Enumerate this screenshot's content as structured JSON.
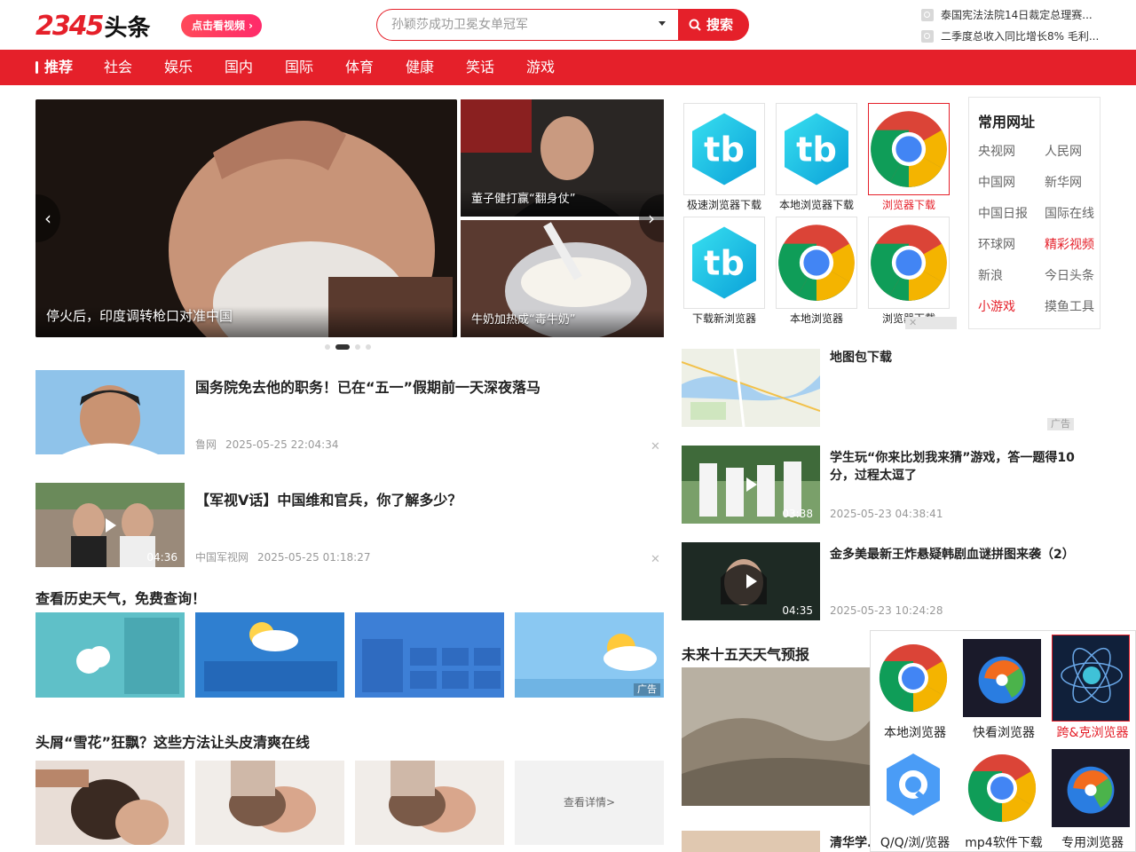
{
  "header": {
    "logo_num": "2345",
    "logo_cn": "头条",
    "video_btn": "点击看视频",
    "search_placeholder": "孙颖莎成功卫冕女单冠军",
    "search_btn": "搜索",
    "hot": [
      "泰国宪法法院14日裁定总理赛...",
      "二季度总收入同比增长8% 毛利..."
    ]
  },
  "nav": [
    "推荐",
    "社会",
    "娱乐",
    "国内",
    "国际",
    "体育",
    "健康",
    "笑话",
    "游戏"
  ],
  "carousel": {
    "main_caption": "停火后，印度调转枪口对准中国",
    "side_top_caption": "董子健打赢“翻身仗”",
    "side_bottom_caption": "牛奶加热成“毒牛奶”"
  },
  "news": [
    {
      "title": "国务院免去他的职务！已在“五一”假期前一天深夜落马",
      "source": "鲁网",
      "time": "2025-05-25 22:04:34"
    },
    {
      "title": "【军视V话】中国维和官兵，你了解多少？",
      "source": "中国军视网",
      "time": "2025-05-25 01:18:27",
      "duration": "04:36"
    }
  ],
  "weather_section": {
    "title": "查看历史天气，免费查询！",
    "ad": "广告"
  },
  "scalp_section": {
    "title": "头屑“雪花”狂飘？这些方法让头皮清爽在线",
    "more": "查看详情>"
  },
  "apps": [
    {
      "label": "极速浏览器下载",
      "icon": "tb-icon"
    },
    {
      "label": "本地浏览器下载",
      "icon": "tb-icon"
    },
    {
      "label": "浏览器下载",
      "icon": "chrome-icon"
    },
    {
      "label": "下载新浏览器",
      "icon": "tb-icon"
    },
    {
      "label": "本地浏览器",
      "icon": "chrome-icon"
    },
    {
      "label": "浏览器下载",
      "icon": "chrome-icon"
    }
  ],
  "sites": {
    "title": "常用网址",
    "items": [
      "央视网",
      "人民网",
      "中国网",
      "新华网",
      "中国日报",
      "国际在线",
      "环球网",
      "精彩视频",
      "新浪",
      "今日头条",
      "小游戏",
      "摸鱼工具"
    ]
  },
  "right_news": [
    {
      "title": "地图包下载",
      "ad": "广告"
    },
    {
      "title": "学生玩“你来比划我来猜”游戏，答一题得10分，过程太逗了",
      "time": "2025-05-23 04:38:41",
      "duration": "03:38"
    },
    {
      "title": "金多美最新王炸悬疑韩剧血谜拼图来袭（2）",
      "time": "2025-05-23 10:24:28",
      "duration": "04:35"
    }
  ],
  "forecast_title": "未来十五天天气预报",
  "partial_title": "清华学...",
  "popup_apps": [
    {
      "label": "本地浏览器",
      "icon": "chrome-icon"
    },
    {
      "label": "快看浏览器",
      "icon": "orb-icon"
    },
    {
      "label": "跨&克浏览器",
      "icon": "atom-icon"
    },
    {
      "label": "Q/Q/浏/览器",
      "icon": "q-icon"
    },
    {
      "label": "mp4软件下载",
      "icon": "chrome-icon"
    },
    {
      "label": "专用浏览器",
      "icon": "orb-icon"
    }
  ],
  "colors": {
    "brand_red": "#e5202a"
  }
}
